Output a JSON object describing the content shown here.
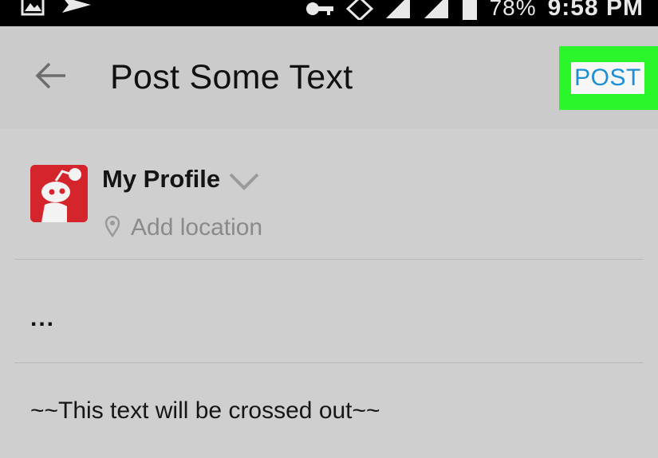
{
  "status_bar": {
    "icons": [
      "image-icon",
      "send-icon",
      "key-icon",
      "data-icon",
      "signal-icon",
      "signal-icon",
      "battery-icon"
    ],
    "battery": "78%",
    "time": "9:58 PM"
  },
  "app_bar": {
    "back_icon": "arrow-left-icon",
    "title": "Post Some Text",
    "post_label": "POST",
    "highlight_color": "#2bf52b",
    "accent_color": "#1b8fd6"
  },
  "profile": {
    "name": "My Profile",
    "dropdown_icon": "chevron-down-icon",
    "location_icon": "map-pin-icon",
    "location_placeholder": "Add location"
  },
  "composer": {
    "lines": [
      "...",
      "~~This text will be crossed out~~"
    ]
  }
}
